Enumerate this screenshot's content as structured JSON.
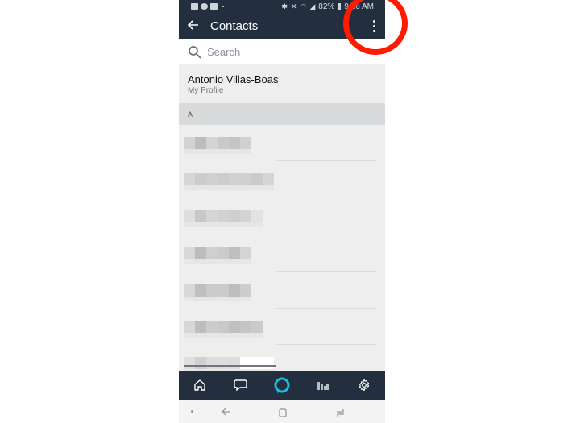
{
  "status_bar": {
    "left_icons": [
      "gallery-icon",
      "settings-notification-icon",
      "email-icon",
      "dot-icon"
    ],
    "right_icons": [
      "bluetooth-icon",
      "mute-icon",
      "wifi-icon",
      "signal-icon"
    ],
    "battery": "82%",
    "time": "9:36 AM"
  },
  "app_bar": {
    "back_icon": "arrow-left-icon",
    "title": "Contacts",
    "menu_icon": "more-vert-icon"
  },
  "search": {
    "placeholder": "Search"
  },
  "profile": {
    "name": "Antonio Villas-Boas",
    "subtitle": "My Profile"
  },
  "section_header": "A",
  "contacts": [
    {
      "label": "[blurred contact]"
    },
    {
      "label": "[blurred contact]"
    },
    {
      "label": "[blurred contact]"
    },
    {
      "label": "[blurred contact]"
    },
    {
      "label": "[blurred contact]"
    },
    {
      "label": "[blurred contact]"
    },
    {
      "label": "[blurred contact]"
    }
  ],
  "bottom_nav": [
    {
      "name": "home",
      "icon": "home-icon"
    },
    {
      "name": "communicate",
      "icon": "chat-bubble-icon"
    },
    {
      "name": "alexa",
      "icon": "alexa-ring-icon"
    },
    {
      "name": "play",
      "icon": "equalizer-icon"
    },
    {
      "name": "devices",
      "icon": "gear-icon"
    }
  ],
  "system_nav": [
    "recent-dot",
    "back-icon",
    "home-square-icon",
    "recents-icon"
  ],
  "colors": {
    "app_bar": "#232f3e",
    "alexa_accent": "#1ebcdc",
    "annotation_ring": "#ff1a00"
  }
}
